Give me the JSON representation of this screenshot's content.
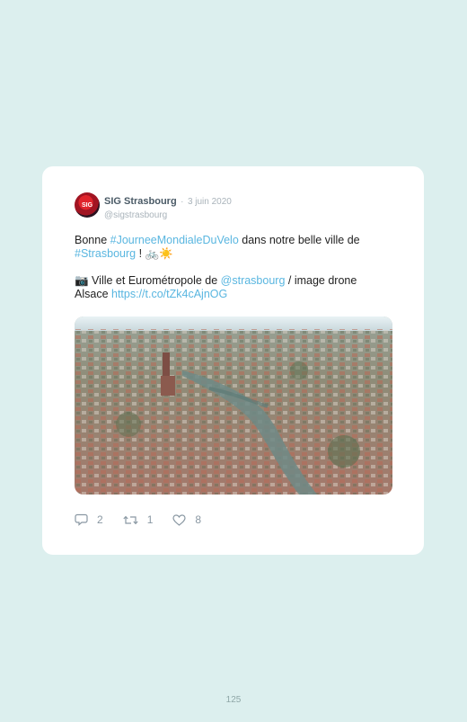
{
  "tweet": {
    "author_name": "SIG Strasbourg",
    "separator": "·",
    "date": "3 juin 2020",
    "handle": "@sigstrasbourg",
    "avatar_text": "SIG",
    "line1_a": "Bonne ",
    "line1_hashtag": "#JourneeMondialeDuVelo",
    "line1_b": " dans notre belle ville de",
    "line2_hashtag": "#Strasbourg",
    "line2_b": " ! ",
    "line2_emoji": "🚲☀️",
    "line3_camera": "📷",
    "line3_a": " Ville et Eurométropole de ",
    "line3_mention": "@strasbourg",
    "line3_b": " / image drone",
    "line4_a": "Alsace ",
    "line4_link": "https://t.co/tZk4cAjnOG",
    "reply_count": "2",
    "retweet_count": "1",
    "like_count": "8"
  },
  "page": {
    "number": "125"
  },
  "colors": {
    "link": "#59b6e0",
    "background": "#dcefee"
  }
}
